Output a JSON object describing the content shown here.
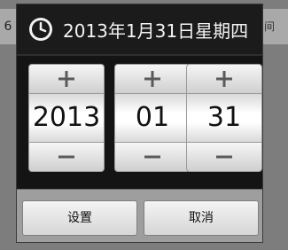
{
  "background": {
    "left_fragment": "6",
    "right_fragment": "间"
  },
  "dialog": {
    "icon": "clock-icon",
    "title": "2013年1月31日星期四",
    "pickers": [
      {
        "name": "year",
        "value": "2013",
        "increment_icon": "plus-icon",
        "decrement_icon": "minus-icon"
      },
      {
        "name": "month",
        "value": "01",
        "increment_icon": "plus-icon",
        "decrement_icon": "minus-icon"
      },
      {
        "name": "day",
        "value": "31",
        "increment_icon": "plus-icon",
        "decrement_icon": "minus-icon"
      }
    ],
    "buttons": {
      "set_label": "设置",
      "cancel_label": "取消"
    }
  },
  "colors": {
    "dialog_background": "#111111",
    "title_text": "#f4f4f4",
    "button_bar": "#9e9e9e",
    "picker_face": "#ffffff"
  }
}
